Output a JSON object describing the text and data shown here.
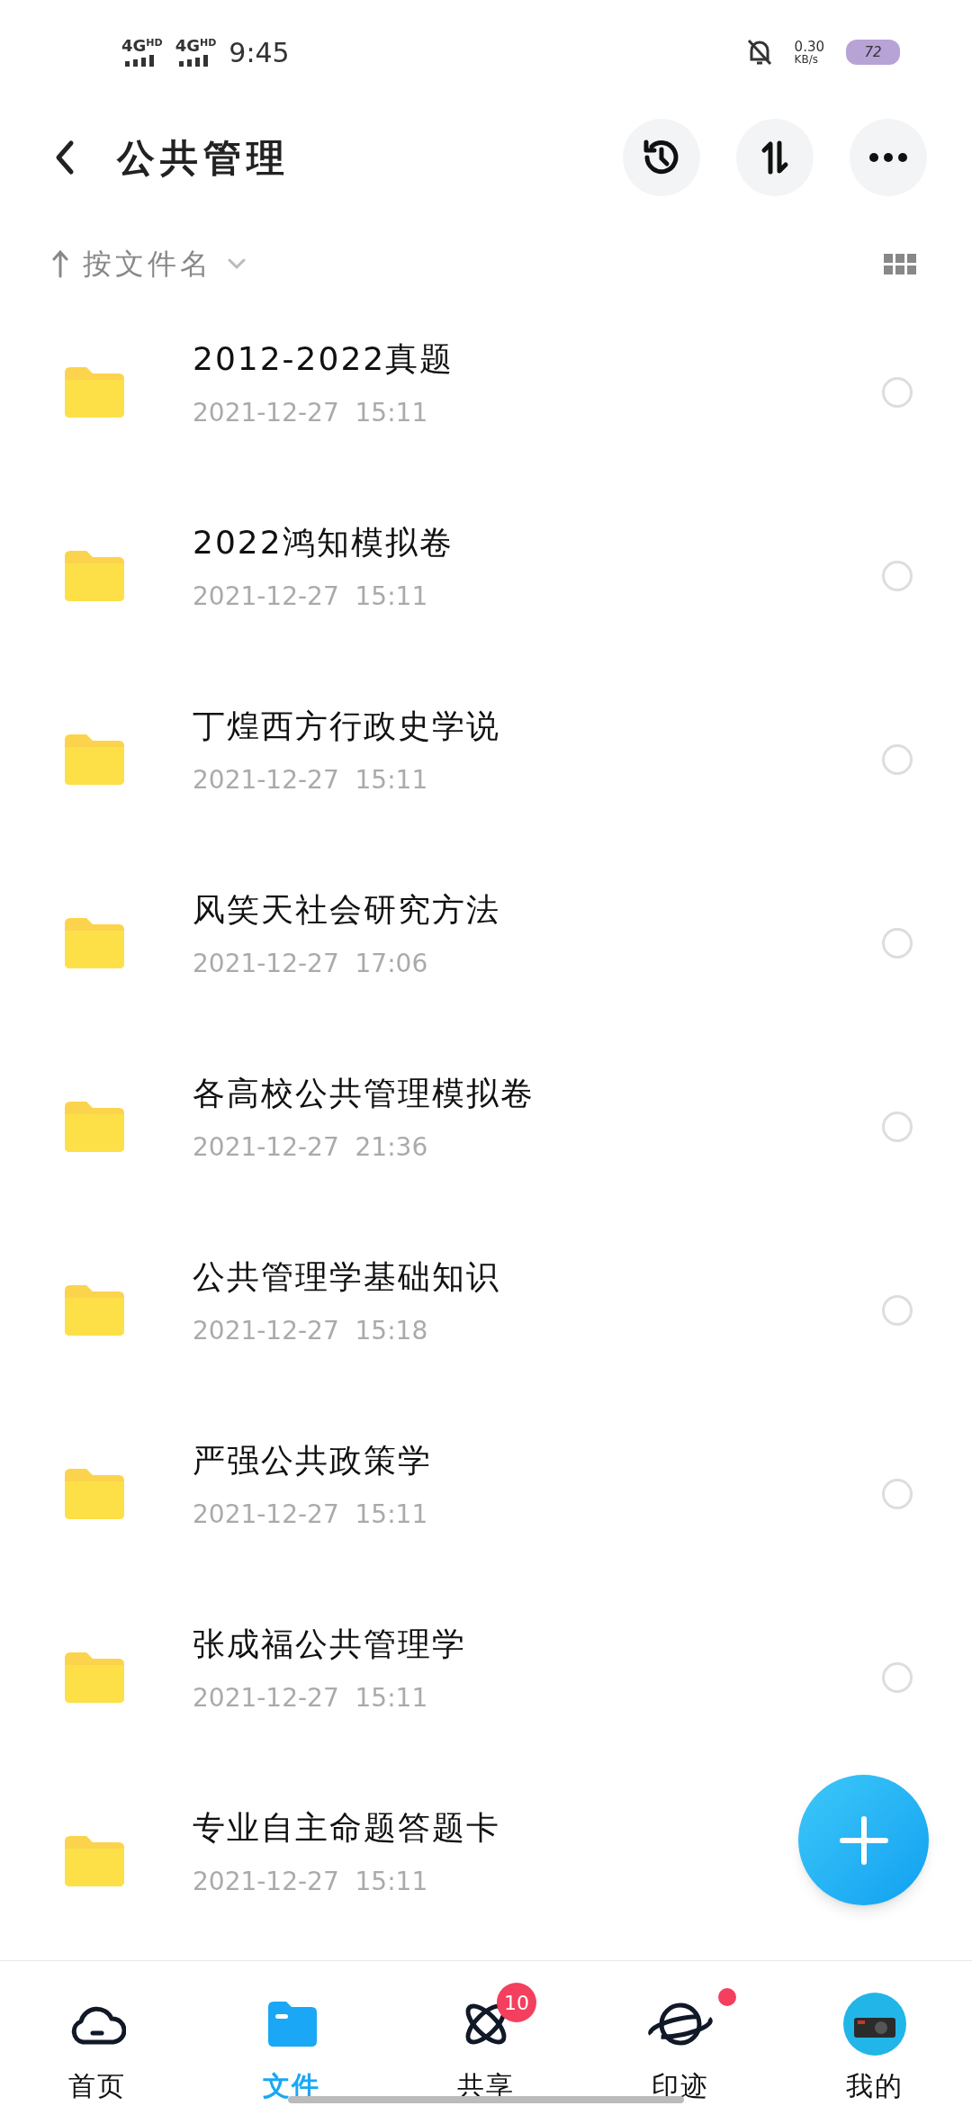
{
  "status_bar": {
    "signal_1": "4G",
    "signal_1_hd": "HD",
    "signal_2": "4G",
    "signal_2_hd": "HD",
    "time": "9:45",
    "speed": "0.30",
    "speed_unit": "KB/s",
    "battery": "72"
  },
  "header": {
    "title": "公共管理"
  },
  "sort_bar": {
    "label": "按文件名"
  },
  "files": [
    {
      "name": "2012-2022真题",
      "date": "2021-12-27  15:11",
      "selected": false
    },
    {
      "name": "2022鸿知模拟卷",
      "date": "2021-12-27  15:11",
      "selected": false
    },
    {
      "name": "丁煌西方行政史学说",
      "date": "2021-12-27  15:11",
      "selected": false
    },
    {
      "name": "风笑天社会研究方法",
      "date": "2021-12-27  17:06",
      "selected": false
    },
    {
      "name": "各高校公共管理模拟卷",
      "date": "2021-12-27  21:36",
      "selected": false
    },
    {
      "name": "公共管理学基础知识",
      "date": "2021-12-27  15:18",
      "selected": false
    },
    {
      "name": "严强公共政策学",
      "date": "2021-12-27  15:11",
      "selected": false
    },
    {
      "name": "张成福公共管理学",
      "date": "2021-12-27  15:11",
      "selected": false
    },
    {
      "name": "专业自主命题答题卡",
      "date": "2021-12-27  15:11"
    }
  ],
  "tabs": [
    {
      "kind": "home",
      "label": "首页",
      "selected": false
    },
    {
      "kind": "files",
      "label": "文件",
      "selected": true
    },
    {
      "kind": "share",
      "label": "共享",
      "selected": false,
      "badge": "10"
    },
    {
      "kind": "trace",
      "label": "印迹",
      "selected": false,
      "dot": true
    },
    {
      "kind": "mine",
      "label": "我的",
      "selected": false
    }
  ]
}
